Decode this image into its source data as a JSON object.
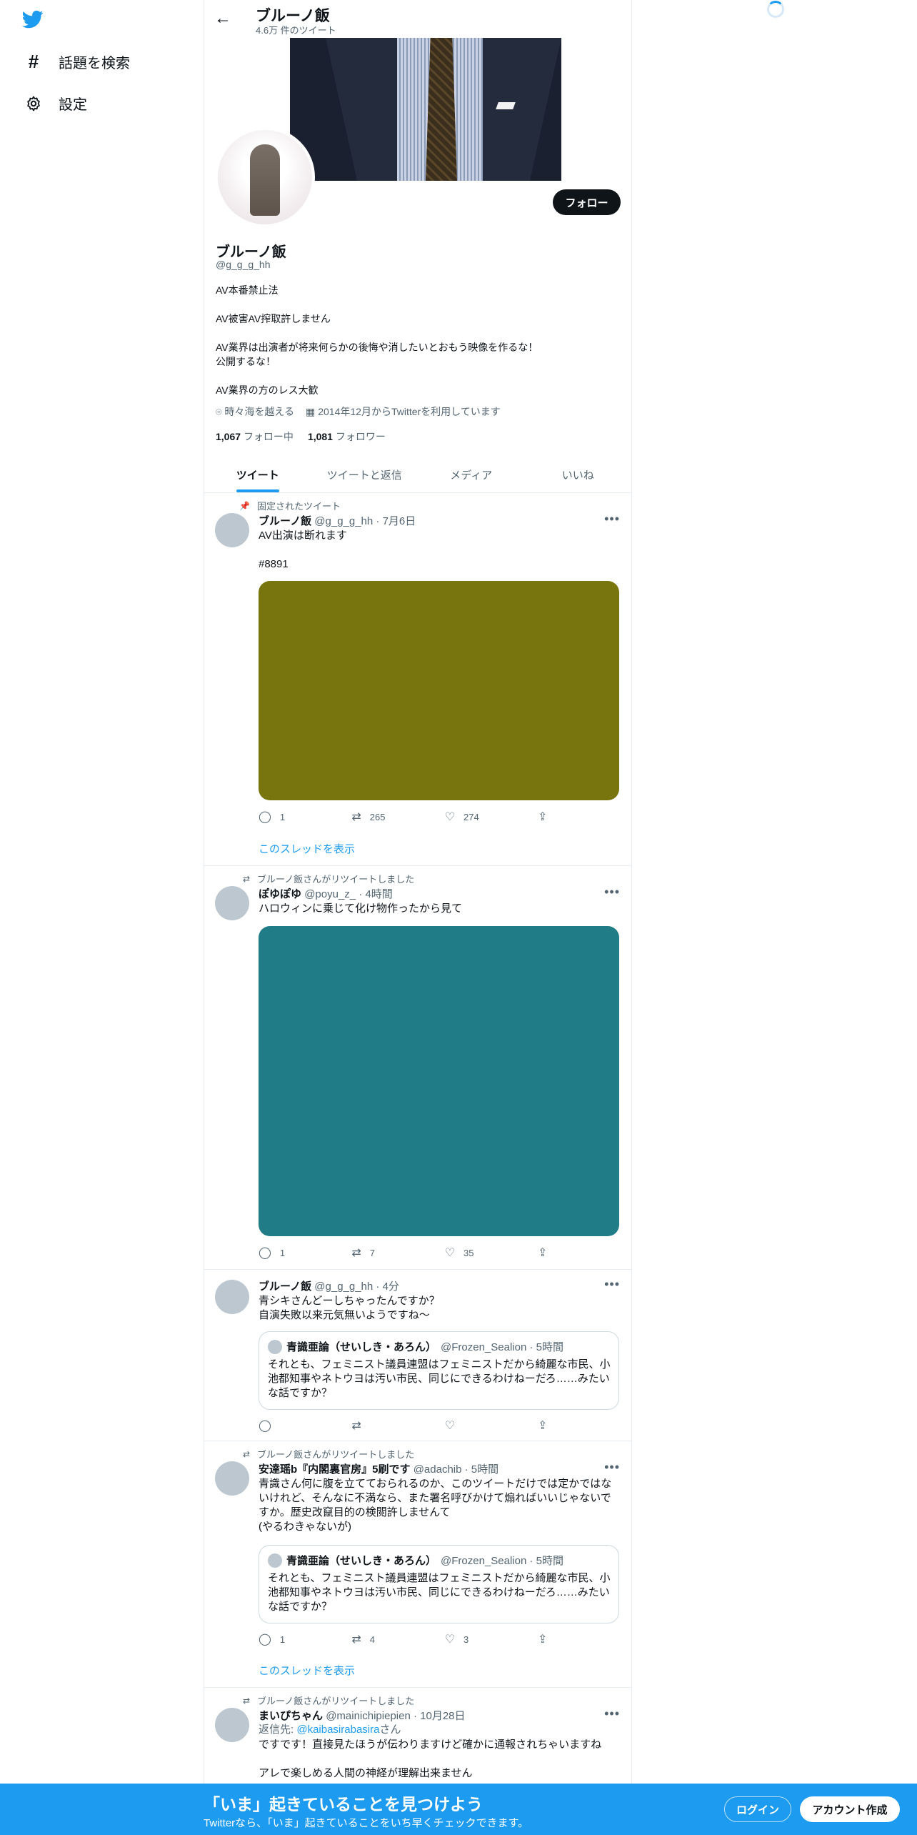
{
  "nav": {
    "items": [
      {
        "icon": "hashtag-icon",
        "label": "話題を検索"
      },
      {
        "icon": "gear-icon",
        "label": "設定"
      }
    ]
  },
  "header": {
    "title": "ブルーノ飯",
    "subtitle": "4.6万 件のツイート"
  },
  "profile": {
    "follow_label": "フォロー",
    "name": "ブルーノ飯",
    "handle": "@g_g_g_hh",
    "bio": [
      "AV本番禁止法",
      "AV被害AV搾取許しません",
      "AV業界は出演者が将来何らかの後悔や消したいとおもう映像を作るな！\n公開するな！",
      "AV業界の方のレス大歓"
    ],
    "location": "時々海を越える",
    "joined": "2014年12月からTwitterを利用しています",
    "following_count": "1,067",
    "following_label": "フォロー中",
    "followers_count": "1,081",
    "followers_label": "フォロワー"
  },
  "tabs": [
    "ツイート",
    "ツイートと返信",
    "メディア",
    "いいね"
  ],
  "tweets": [
    {
      "context": "固定されたツイート",
      "name": "ブルーノ飯",
      "meta": "@g_g_g_hh · 7月6日",
      "text": "AV出演は断れます\n\n#8891",
      "media_color": "#79750e",
      "replies": "1",
      "retweets": "265",
      "likes": "274",
      "show_thread": "このスレッドを表示"
    },
    {
      "context": "ブルーノ飯さんがリツイートしました",
      "name": "ぽゆぽゆ",
      "meta": "@poyu_z_ · 4時間",
      "text": "ハロウィンに乗じて化け物作ったから見て",
      "media_color": "#207c86",
      "replies": "1",
      "retweets": "7",
      "likes": "35"
    },
    {
      "name": "ブルーノ飯",
      "meta": "@g_g_g_hh · 4分",
      "text": "青シキさんどーしちゃったんですか？\n自演失敗以来元気無いようですね～",
      "quote": {
        "name": "青識亜論（せいしき・あろん）",
        "meta": "@Frozen_Sealion · 5時間",
        "text": "それとも、フェミニスト議員連盟はフェミニストだから綺麗な市民、小池都知事やネトウヨは汚い市民、同じにできるわけねーだろ……みたいな話ですか？"
      }
    },
    {
      "context": "ブルーノ飯さんがリツイートしました",
      "name": "安達瑶b『内閣裏官房』5刷です",
      "meta": "@adachib · 5時間",
      "text": "青識さん何に腹を立てておられるのか、このツイートだけでは定かではないけれど、そんなに不満なら、また署名呼びかけて煽ればいいじゃないですか。歴史改竄目的の検閲許しませんて\n(やるわきゃないが)",
      "quote": {
        "name": "青識亜論（せいしき・あろん）",
        "meta": "@Frozen_Sealion · 5時間",
        "text": "それとも、フェミニスト議員連盟はフェミニストだから綺麗な市民、小池都知事やネトウヨは汚い市民、同じにできるわけねーだろ……みたいな話ですか？"
      },
      "replies": "1",
      "retweets": "4",
      "likes": "3",
      "show_thread": "このスレッドを表示"
    },
    {
      "context": "ブルーノ飯さんがリツイートしました",
      "name": "まいぴちゃん",
      "meta": "@mainichipiepien · 10月28日",
      "reply_prefix": "返信先: ",
      "reply_to": "@kaibasirabasira",
      "reply_suffix": "さん",
      "text": "ですです！直接見たほうが伝わりますけど確かに通報されちゃいますね\n\nアレで楽しめる人間の神経が理解出来ません"
    }
  ],
  "bottom_bar": {
    "title": "「いま」起きていることを見つけよう",
    "subtitle": "Twitterなら、「いま」起きていることをいち早くチェックできます。",
    "login": "ログイン",
    "signup": "アカウント作成"
  },
  "colors": {
    "accent": "#1d9bf0",
    "text": "#0f1419",
    "muted": "#536471"
  }
}
